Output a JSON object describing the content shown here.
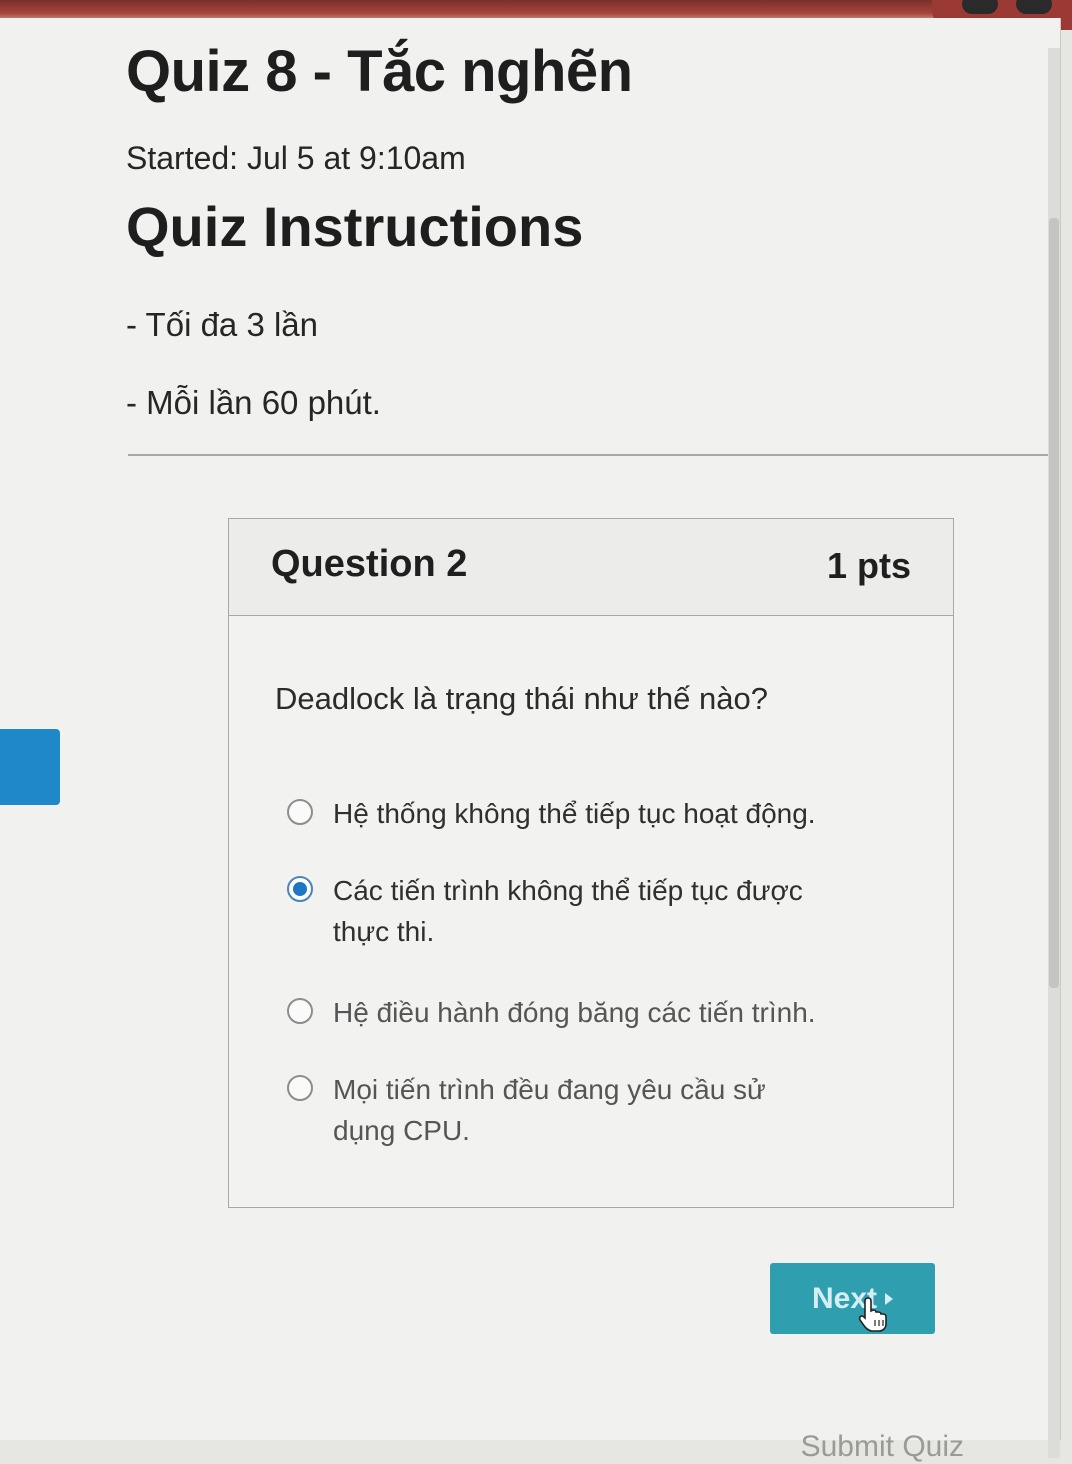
{
  "quiz": {
    "title": "Quiz 8 - Tắc nghẽn",
    "started": "Started: Jul 5 at 9:10am",
    "instructions_heading": "Quiz Instructions",
    "instructions": [
      "- Tối đa 3 lần",
      "- Mỗi lần 60 phút."
    ]
  },
  "question": {
    "title": "Question 2",
    "points": "1 pts",
    "text": "Deadlock là trạng thái như thế nào?",
    "selected_index": 1,
    "options": [
      "Hệ thống không thể tiếp tục hoạt động.",
      "Các tiến trình không thể tiếp tục được thực thi.",
      "Hệ điều hành đóng băng các tiến trình.",
      "Mọi tiến trình đều đang yêu cầu sử dụng CPU."
    ]
  },
  "navigation": {
    "next_label": "Next",
    "submit_label": "Submit Quiz"
  },
  "icons": {
    "cursor": "hand-pointer-icon",
    "next_arrow": "play-triangle-icon"
  },
  "colors": {
    "next_button": "#2f9fb0",
    "radio_selected": "#1f76c2",
    "side_tab": "#1e88c9"
  }
}
